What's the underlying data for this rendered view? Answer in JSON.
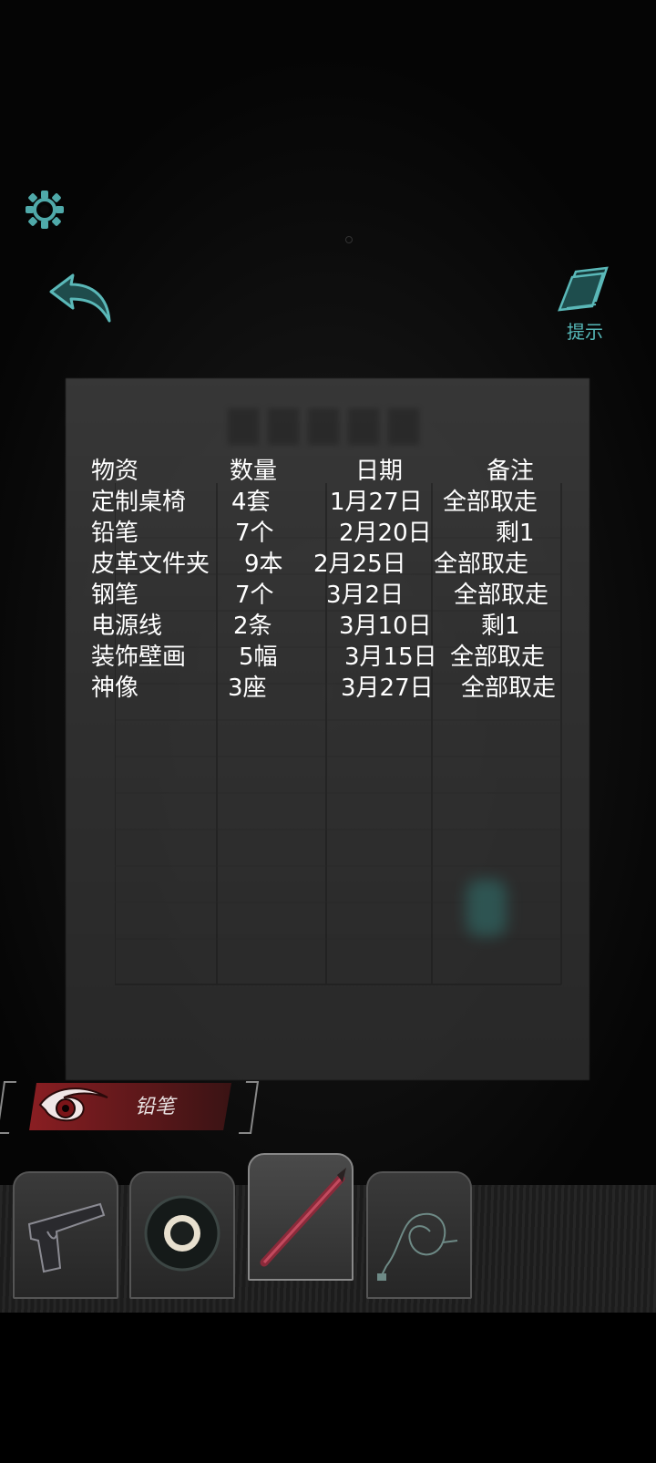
{
  "settings_icon": "gear-icon",
  "back_icon": "back-arrow-icon",
  "hint": {
    "icon": "book-icon",
    "label": "提示"
  },
  "ledger": {
    "headers": [
      "物资",
      "数量",
      "日期",
      "备注"
    ],
    "rows": [
      [
        "定制桌椅",
        "4套",
        "1月27日",
        "全部取走"
      ],
      [
        "铅笔",
        "7个",
        "2月20日",
        "剩1"
      ],
      [
        "皮革文件夹",
        "9本",
        "2月25日",
        "全部取走"
      ],
      [
        "钢笔",
        "7个",
        "3月2日",
        "全部取走"
      ],
      [
        "电源线",
        "2条",
        "3月10日",
        "剩1"
      ],
      [
        "装饰壁画",
        "5幅",
        "3月15日",
        "全部取走"
      ],
      [
        "神像",
        "3座",
        "3月27日",
        "全部取走"
      ]
    ]
  },
  "selected_item": {
    "label": "铅笔",
    "icon": "eye-emblem-icon"
  },
  "inventory": [
    {
      "name": "pistol",
      "icon": "pistol-icon",
      "selected": false
    },
    {
      "name": "tape",
      "icon": "tape-roll-icon",
      "selected": false
    },
    {
      "name": "pencil",
      "icon": "pencil-icon",
      "selected": true
    },
    {
      "name": "cable",
      "icon": "power-cable-icon",
      "selected": false
    }
  ],
  "colors": {
    "accent": "#56b8b8",
    "banner": "#8a1e22",
    "text": "#ffffff"
  }
}
